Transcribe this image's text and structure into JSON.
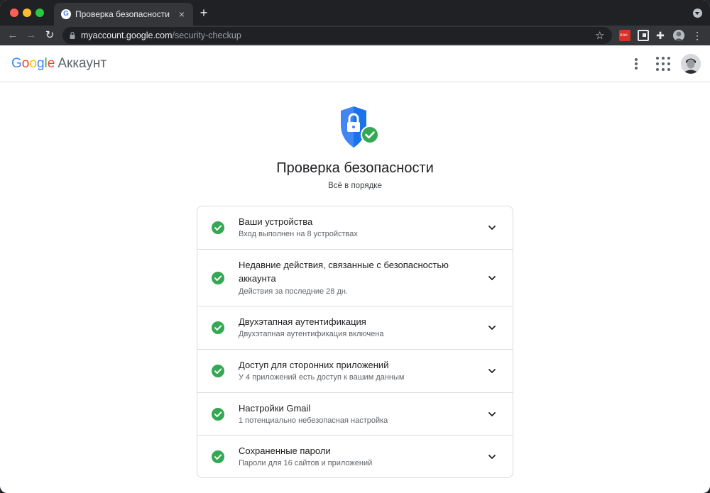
{
  "browser": {
    "tab_title": "Проверка безопасности",
    "tab_favicon": "G",
    "tab_close": "×",
    "new_tab": "+",
    "url_host": "myaccount.google.com",
    "url_path": "/security-checkup",
    "back": "←",
    "forward": "→",
    "reload": "↻",
    "star": "☆",
    "extension_puzzle": "✚",
    "extension_menu": "⋮",
    "ext_red_label": "ooo"
  },
  "header": {
    "logo": [
      "G",
      "o",
      "o",
      "g",
      "l",
      "e"
    ],
    "product": "Аккаунт"
  },
  "hero": {
    "title": "Проверка безопасности",
    "subtitle": "Всё в порядке"
  },
  "items": [
    {
      "title": "Ваши устройства",
      "description": "Вход выполнен на 8 устройствах"
    },
    {
      "title": "Недавние действия, связанные с безопасностью аккаунта",
      "description": "Действия за последние 28 дн."
    },
    {
      "title": "Двухэтапная аутентификация",
      "description": "Двухэтапная аутентификация включена"
    },
    {
      "title": "Доступ для сторонних приложений",
      "description": "У 4 приложений есть доступ к вашим данным"
    },
    {
      "title": "Настройки Gmail",
      "description": "1 потенциально небезопасная настройка"
    },
    {
      "title": "Сохраненные пароли",
      "description": "Пароли для 16 сайтов и приложений"
    }
  ],
  "colors": {
    "shield": "#4285f4",
    "check": "#34a853",
    "text_primary": "#202124",
    "text_secondary": "#5f6368"
  }
}
